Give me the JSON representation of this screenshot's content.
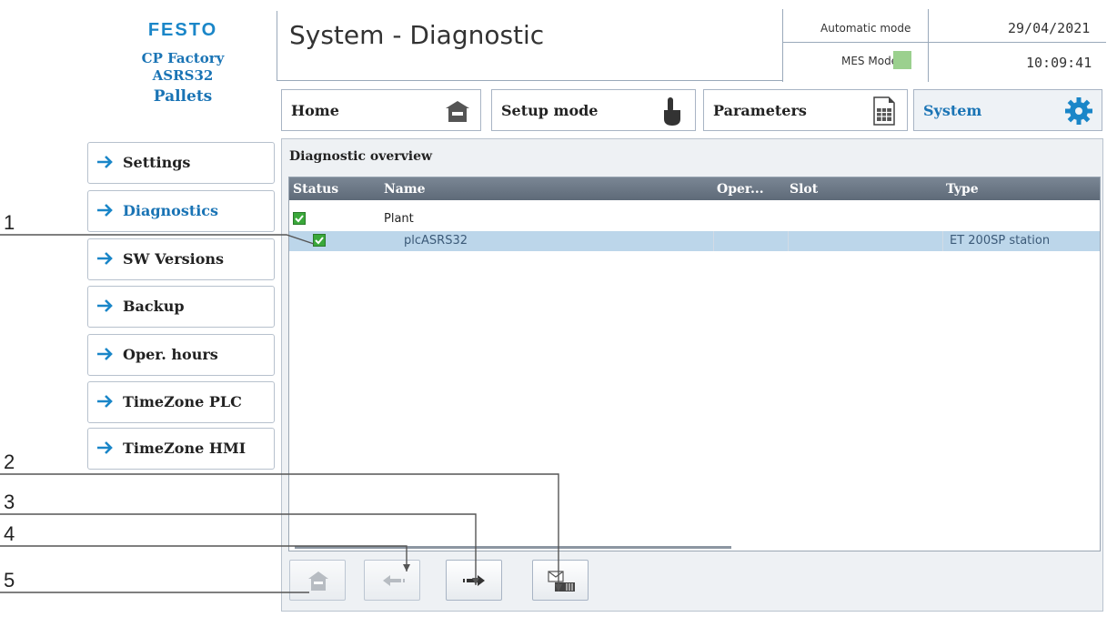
{
  "brand": {
    "logo": "FESTO",
    "line1": "CP Factory",
    "line2": "ASRS32",
    "line3": "Pallets"
  },
  "header": {
    "title": "System - Diagnostic",
    "mode": "Automatic mode",
    "mes_mode": "MES Mode",
    "mes_indicator_color": "#9bd08e",
    "date": "29/04/2021",
    "time": "10:09:41"
  },
  "tabs": [
    {
      "label": "Home",
      "icon": "home-icon",
      "active": false
    },
    {
      "label": "Setup mode",
      "icon": "hand-pointer-icon",
      "active": false
    },
    {
      "label": "Parameters",
      "icon": "document-grid-icon",
      "active": false
    },
    {
      "label": "System",
      "icon": "gear-icon",
      "active": true
    }
  ],
  "sidebar": {
    "items": [
      {
        "label": "Settings"
      },
      {
        "label": "Diagnostics"
      },
      {
        "label": "SW Versions"
      },
      {
        "label": "Backup"
      },
      {
        "label": "Oper. hours"
      },
      {
        "label": "TimeZone PLC"
      },
      {
        "label": "TimeZone HMI"
      }
    ]
  },
  "panel": {
    "title": "Diagnostic overview",
    "columns": [
      "Status",
      "Name",
      "Oper...",
      "Slot",
      "Type"
    ],
    "rows": [
      {
        "status": "ok",
        "name": "Plant",
        "oper": "",
        "slot": "",
        "type": "",
        "selected": false
      },
      {
        "status": "ok",
        "name": "plcASRS32",
        "oper": "",
        "slot": "",
        "type": "ET 200SP station",
        "selected": true
      }
    ]
  },
  "toolbar": {
    "buttons": [
      {
        "name": "home-button",
        "icon": "home-icon",
        "enabled": false
      },
      {
        "name": "back-button",
        "icon": "arrow-left-icon",
        "enabled": false
      },
      {
        "name": "forward-button",
        "icon": "arrow-right-icon",
        "enabled": true
      },
      {
        "name": "messages-button",
        "icon": "envelope-icon",
        "enabled": true
      }
    ]
  },
  "callouts": [
    "1",
    "2",
    "3",
    "4",
    "5"
  ],
  "colors": {
    "accent_blue": "#1a86c8",
    "header_dark": "#5e6a78",
    "selection": "#bcd6ea",
    "ok_green": "#3aa83a"
  }
}
